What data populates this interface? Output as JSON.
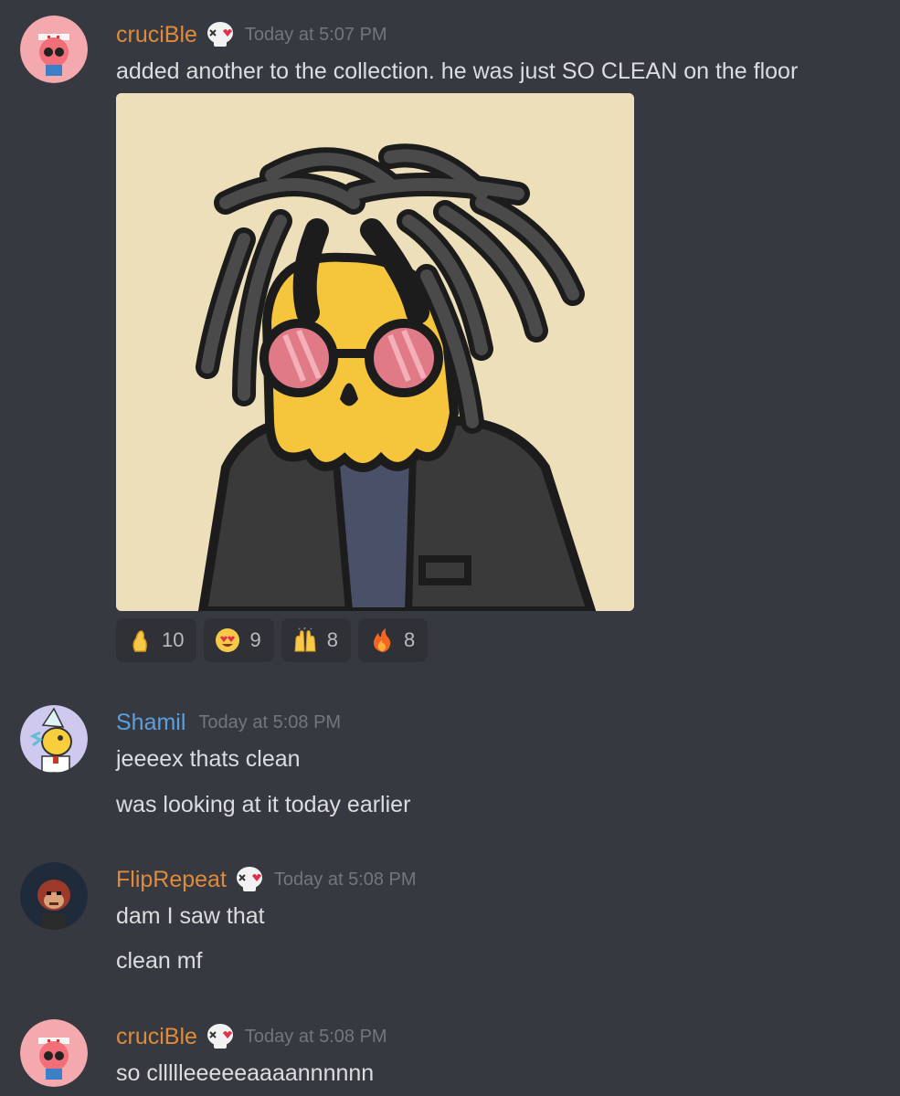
{
  "colors": {
    "background": "#36393f",
    "username_orange": "#e08a3b",
    "username_blue": "#5aa0e0",
    "timestamp": "#72767d",
    "message_text": "#dcddde",
    "reaction_bg": "#2f3136"
  },
  "messages": [
    {
      "author": "cruciBle",
      "author_color": "#e08a3b",
      "badge": "skull-heart-eyes-icon",
      "timestamp": "Today at 5:07 PM",
      "lines": [
        "added another to the collection. he was just SO CLEAN on the floor"
      ],
      "attachment": "nft-skull-dreadlocks-image",
      "reactions": [
        {
          "emoji": "pinched-fingers-icon",
          "count": "10"
        },
        {
          "emoji": "heart-eyes-icon",
          "count": "9"
        },
        {
          "emoji": "raised-hands-icon",
          "count": "8"
        },
        {
          "emoji": "fire-icon",
          "count": "8"
        }
      ]
    },
    {
      "author": "Shamil",
      "author_color": "#5aa0e0",
      "timestamp": "Today at 5:08 PM",
      "lines": [
        "jeeeex thats clean",
        "was looking at it today earlier"
      ]
    },
    {
      "author": "FlipRepeat",
      "author_color": "#e08a3b",
      "badge": "skull-heart-eyes-icon",
      "timestamp": "Today at 5:08 PM",
      "lines": [
        "dam I saw that",
        "clean mf"
      ]
    },
    {
      "author": "cruciBle",
      "author_color": "#e08a3b",
      "badge": "skull-heart-eyes-icon",
      "timestamp": "Today at 5:08 PM",
      "lines": [
        "so cllllleeeeeaaaannnnnn"
      ]
    }
  ]
}
